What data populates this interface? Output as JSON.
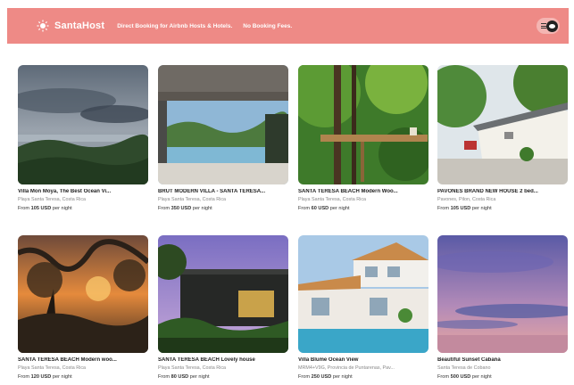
{
  "header": {
    "brand": "SantaHost",
    "tagline": "Direct Booking for Airbnb Hosts & Hotels.",
    "nofees": "No Booking Fees."
  },
  "listings": [
    {
      "title": "Villa Mon Moya, The Best Ocean Vi...",
      "location": "Playa Santa Teresa, Costa Rica",
      "from": "From",
      "price": "105 USD",
      "per": "per night"
    },
    {
      "title": "BRUT MODERN VILLA - SANTA TERESA...",
      "location": "Playa Santa Teresa, Costa Rica",
      "from": "From",
      "price": "350 USD",
      "per": "per night"
    },
    {
      "title": "SANTA TERESA BEACH Modern Woo...",
      "location": "Playa Santa Teresa, Costa Rica",
      "from": "From",
      "price": "60 USD",
      "per": "per night"
    },
    {
      "title": "PAVONES BRAND NEW HOUSE 2 bed...",
      "location": "Pavones, Pilon, Costa Rica",
      "from": "From",
      "price": "105 USD",
      "per": "per night"
    },
    {
      "title": "SANTA TERESA BEACH Modern woo...",
      "location": "Playa Santa Teresa, Costa Rica",
      "from": "From",
      "price": "120 USD",
      "per": "per night"
    },
    {
      "title": "SANTA TERESA BEACH Lovely house",
      "location": "Playa Santa Teresa, Costa Rica",
      "from": "From",
      "price": "80 USD",
      "per": "per night"
    },
    {
      "title": "Villa Blume Ocean View",
      "location": "MRM4+V9G, Provincia de Puntarenas, Pav...",
      "from": "From",
      "price": "250 USD",
      "per": "per night"
    },
    {
      "title": "Beautiful Sunset Cabana",
      "location": "Santa Teresa de Cobano",
      "from": "From",
      "price": "500 USD",
      "per": "per night"
    }
  ],
  "colors": {
    "header_bg": "#ee8a86"
  },
  "icons": {
    "brand": "sun-logo-icon",
    "menu": "menu-icon",
    "user": "user-avatar-icon"
  }
}
